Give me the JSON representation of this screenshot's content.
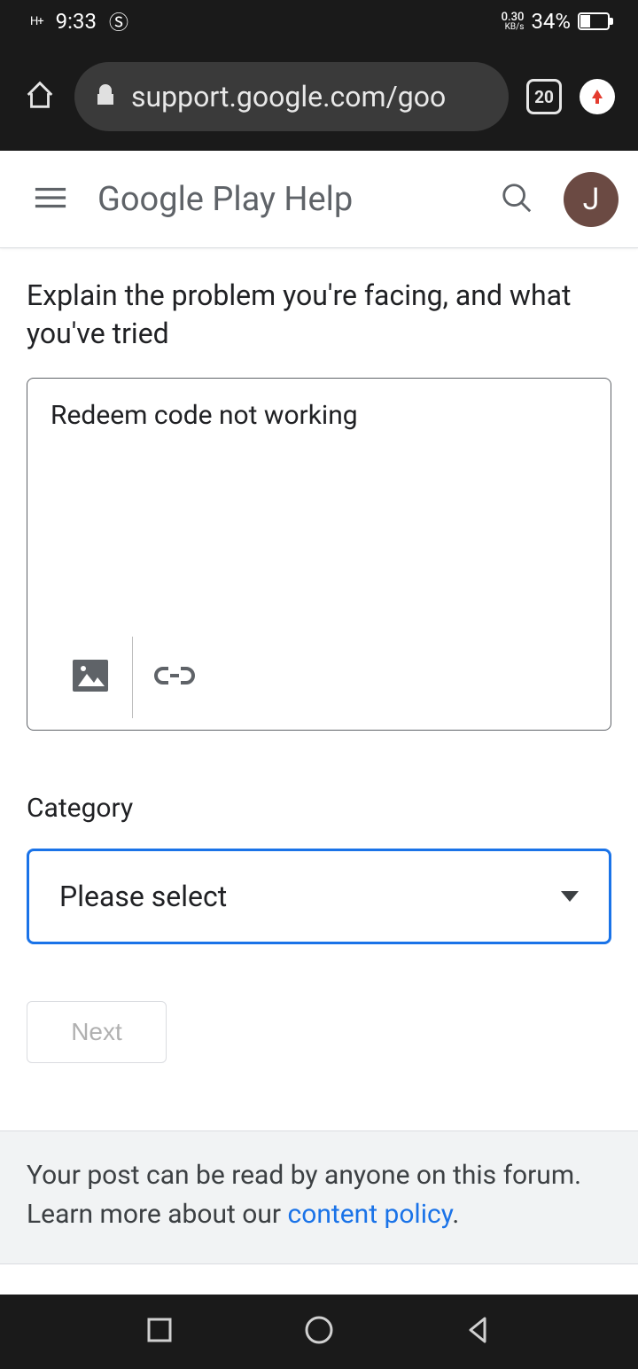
{
  "status": {
    "signal_indicator": "H+",
    "time": "9:33",
    "data_rate_value": "0.30",
    "data_rate_unit": "KB/s",
    "battery_pct": "34%"
  },
  "browser": {
    "url": "support.google.com/goo",
    "tab_count": "20"
  },
  "header": {
    "title": "Google Play Help",
    "avatar_initial": "J"
  },
  "form": {
    "explain_label": "Explain the problem you're facing, and what you've tried",
    "explain_value": "Redeem code not working",
    "category_label": "Category",
    "category_placeholder": "Please select",
    "next_label": "Next"
  },
  "notice": {
    "text_before": "Your post can be read by anyone on this forum. Learn more about our ",
    "link_text": "content policy",
    "text_after": "."
  }
}
